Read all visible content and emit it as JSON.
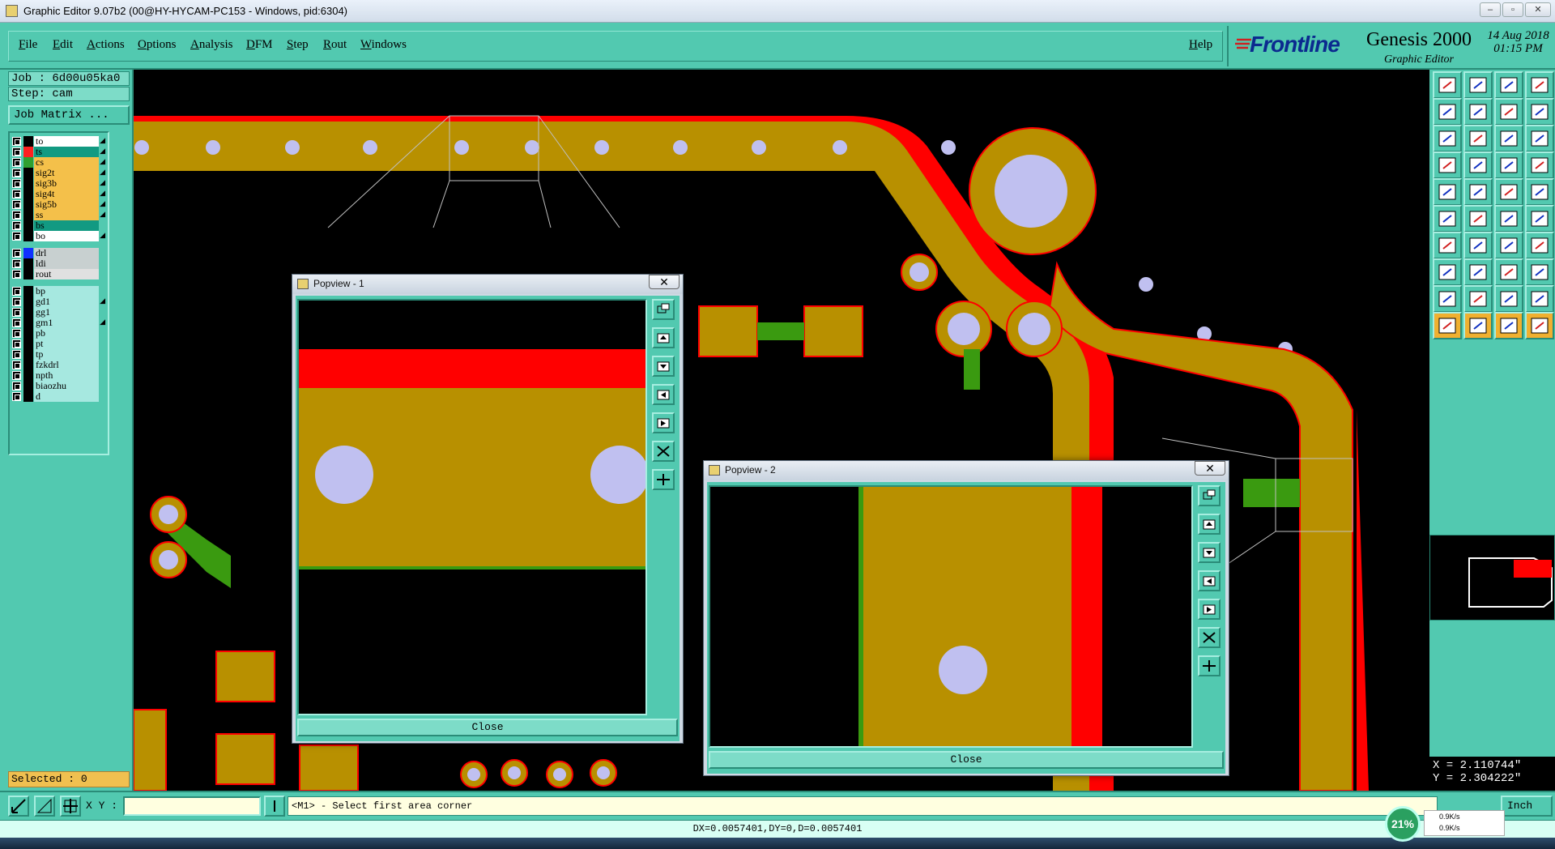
{
  "window": {
    "title": "Graphic Editor 9.07b2 (00@HY-HYCAM-PC153 - Windows, pid:6304)"
  },
  "menu": {
    "items": [
      "File",
      "Edit",
      "Actions",
      "Options",
      "Analysis",
      "DFM",
      "Step",
      "Rout",
      "Windows"
    ],
    "help": "Help"
  },
  "brand": {
    "logo": "Frontline",
    "product": "Genesis 2000",
    "subtitle": "Graphic Editor",
    "date": "14 Aug 2018",
    "time": "01:15 PM"
  },
  "job": {
    "job_label": "Job : 6d00u05ka0",
    "step_label": "Step: cam",
    "matrix_button": "Job Matrix ..."
  },
  "layers": {
    "group1": [
      {
        "name": "to",
        "color": "#000000",
        "bg": "#ffffff",
        "flag": "◢"
      },
      {
        "name": "ts",
        "color": "#ff2020",
        "bg": "#129a82",
        "flag": "◢"
      },
      {
        "name": "cs",
        "color": "#30a030",
        "bg": "#f4c04a",
        "flag": "◢"
      },
      {
        "name": "sig2t",
        "color": "#000000",
        "bg": "#f4c04a",
        "flag": "◢"
      },
      {
        "name": "sig3b",
        "color": "#000000",
        "bg": "#f4c04a",
        "flag": "◢"
      },
      {
        "name": "sig4t",
        "color": "#000000",
        "bg": "#f4c04a",
        "flag": "◢"
      },
      {
        "name": "sig5b",
        "color": "#000000",
        "bg": "#f4c04a",
        "flag": "◢"
      },
      {
        "name": "ss",
        "color": "#000000",
        "bg": "#f4c04a",
        "flag": "◢"
      },
      {
        "name": "bs",
        "color": "#000000",
        "bg": "#129a82",
        "flag": ""
      },
      {
        "name": "bo",
        "color": "#000000",
        "bg": "#ffffff",
        "flag": "◢"
      }
    ],
    "group2": [
      {
        "name": "drl",
        "color": "#1030ff",
        "bg": "#c8d0d0",
        "flag": ""
      },
      {
        "name": "ldi",
        "color": "#000000",
        "bg": "#c8d0d0",
        "flag": ""
      },
      {
        "name": "rout",
        "color": "#000000",
        "bg": "#e0e0e0",
        "flag": ""
      }
    ],
    "group3": [
      {
        "name": "bp",
        "color": "#000000",
        "bg": "#a6e8e0",
        "flag": ""
      },
      {
        "name": "gd1",
        "color": "#000000",
        "bg": "#a6e8e0",
        "flag": "◢"
      },
      {
        "name": "gg1",
        "color": "#000000",
        "bg": "#a6e8e0",
        "flag": ""
      },
      {
        "name": "gm1",
        "color": "#000000",
        "bg": "#a6e8e0",
        "flag": "◢"
      },
      {
        "name": "pb",
        "color": "#000000",
        "bg": "#a6e8e0",
        "flag": ""
      },
      {
        "name": "pt",
        "color": "#000000",
        "bg": "#a6e8e0",
        "flag": ""
      },
      {
        "name": "tp",
        "color": "#000000",
        "bg": "#a6e8e0",
        "flag": ""
      },
      {
        "name": "fzkdrl",
        "color": "#000000",
        "bg": "#a6e8e0",
        "flag": ""
      },
      {
        "name": "npth",
        "color": "#000000",
        "bg": "#a6e8e0",
        "flag": ""
      },
      {
        "name": "biaozhu",
        "color": "#000000",
        "bg": "#a6e8e0",
        "flag": ""
      },
      {
        "name": "d",
        "color": "#000000",
        "bg": "#a6e8e0",
        "flag": ""
      }
    ]
  },
  "selected": "Selected : 0",
  "popview1": {
    "title": "Popview - 1",
    "close_label": "Close",
    "close_x": "✕"
  },
  "popview2": {
    "title": "Popview - 2",
    "close_label": "Close",
    "close_x": "✕"
  },
  "status": {
    "xy_label": "X Y :",
    "xy_value": "",
    "prompt": "<M1> - Select first area corner",
    "units": "Inch",
    "measure": "DX=0.0057401,DY=0,D=0.0057401"
  },
  "coords": {
    "x": "X = 2.110744\"",
    "y": "Y = 2.304222\""
  },
  "network": {
    "percent": "21%",
    "up": "0.9K/s",
    "down": "0.9K/s"
  },
  "colors": {
    "panel": "#52c9b0",
    "copper": "#b89000",
    "soldermask": "#ff0000",
    "trace_green": "#3a9a10",
    "drill": "#c0c0f0"
  }
}
